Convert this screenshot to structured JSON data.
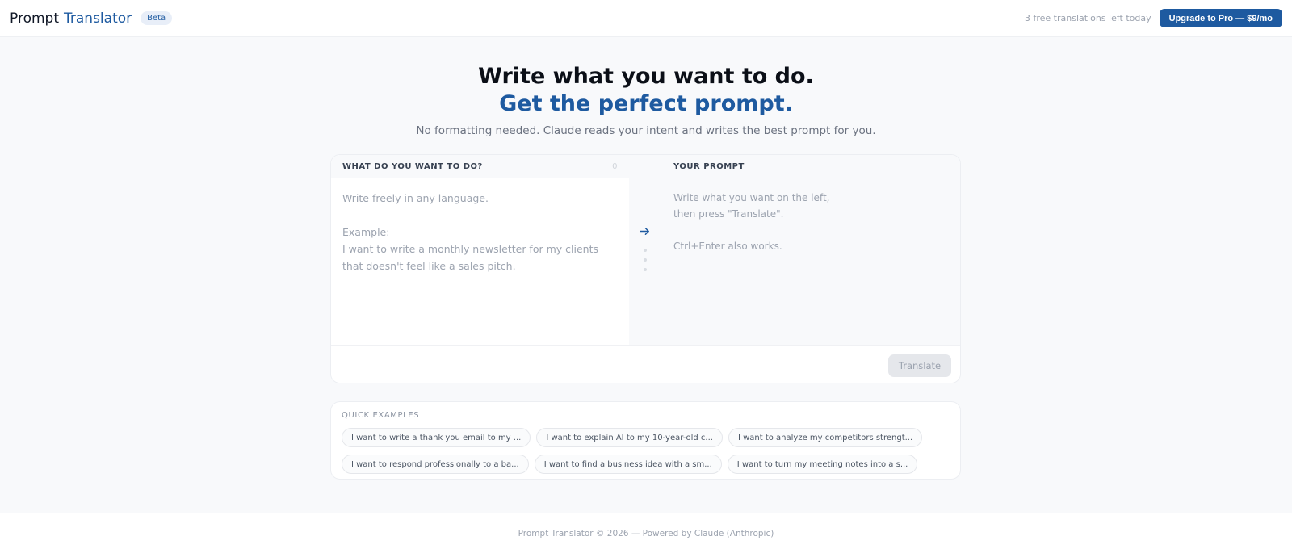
{
  "header": {
    "brand_a": "Prompt",
    "brand_b": "Translator",
    "beta": "Beta",
    "free_left": "3 free translations left today",
    "upgrade_label": "Upgrade to Pro — $9/mo"
  },
  "hero": {
    "line1": "Write what you want to do.",
    "line2": "Get the perfect prompt.",
    "subtitle": "No formatting needed. Claude reads your intent and writes the best prompt for you."
  },
  "input": {
    "label": "WHAT DO YOU WANT TO DO?",
    "counter": "0",
    "placeholder_1": "Write freely in any language.",
    "placeholder_2": "Example:",
    "placeholder_3": "I want to write a monthly newsletter for my clients that doesn't feel like a sales pitch."
  },
  "output": {
    "label": "YOUR PROMPT",
    "hint_1": "Write what you want on the left,",
    "hint_2": "then press \"Translate\".",
    "hint_3": "Ctrl+Enter also works."
  },
  "translate_label": "Translate",
  "examples": {
    "title": "QUICK EXAMPLES",
    "items": [
      "I want to write a thank you email to my ...",
      "I want to explain AI to my 10-year-old c...",
      "I want to analyze my competitors strengt...",
      "I want to respond professionally to a ba...",
      "I want to find a business idea with a sm...",
      "I want to turn my meeting notes into a s..."
    ]
  },
  "footer": "Prompt Translator © 2026 — Powered by Claude (Anthropic)",
  "colors": {
    "accent": "#1e5aa0",
    "background": "#f8f9fb"
  }
}
